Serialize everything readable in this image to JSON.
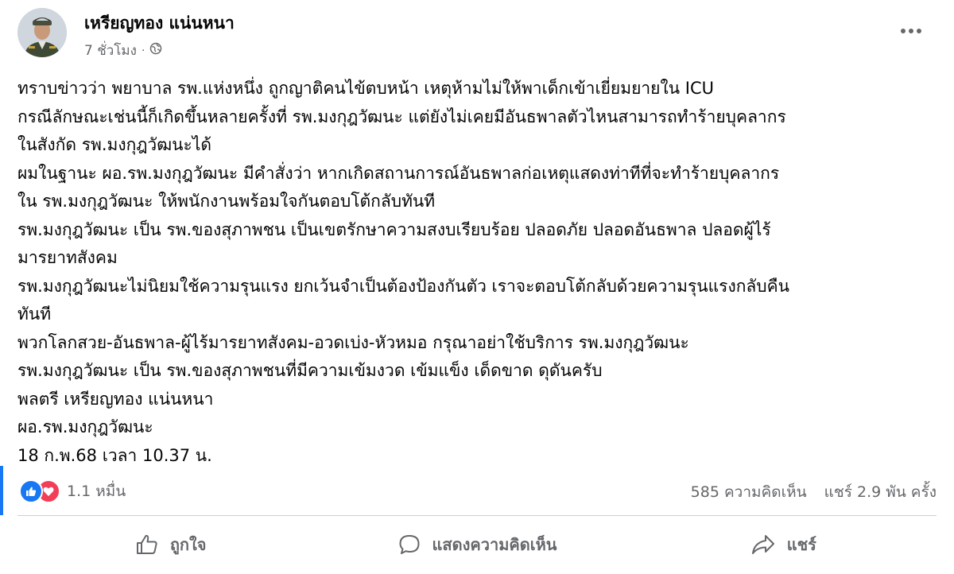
{
  "post": {
    "author": "เหรียญทอง แน่นหนา",
    "time": "7 ชั่วโมง",
    "privacy_icon": "globe-icon",
    "text_lines": [
      "ทราบข่าวว่า พยาบาล รพ.แห่งหนึ่ง ถูกญาติคนไข้ตบหน้า เหตุห้ามไม่ให้พาเด็กเข้าเยี่ยมยายใน ICU",
      "กรณีลักษณะเช่นนี้ก็เกิดขึ้นหลายครั้งที่ รพ.มงกุฎวัฒนะ แต่ยังไม่เคยมีอันธพาลตัวไหนสามารถทำร้ายบุคลากร",
      "ในสังกัด รพ.มงกุฎวัฒนะได้",
      "ผมในฐานะ ผอ.รพ.มงกุฎวัฒนะ มีคำสั่งว่า หากเกิดสถานการณ์อันธพาลก่อเหตุแสดงท่าทีที่จะทำร้ายบุคลากร",
      "ใน รพ.มงกุฎวัฒนะ ให้พนักงานพร้อมใจกันตอบโต้กลับทันที",
      "รพ.มงกุฎวัฒนะ เป็น รพ.ของสุภาพชน เป็นเขตรักษาความสงบเรียบร้อย ปลอดภัย ปลอดอันธพาล ปลอดผู้ไร้",
      "มารยาทสังคม",
      "รพ.มงกุฎวัฒนะไม่นิยมใช้ความรุนแรง ยกเว้นจำเป็นต้องป้องกันตัว เราจะตอบโต้กลับด้วยความรุนแรงกลับคืน",
      "ทันที",
      "พวกโลกสวย-อันธพาล-ผู้ไร้มารยาทสังคม-อวดเบ่ง-หัวหมอ กรุณาอย่าใช้บริการ รพ.มงกุฎวัฒนะ",
      "รพ.มงกุฎวัฒนะ เป็น รพ.ของสุภาพชนที่มีความเข้มงวด เข้มแข็ง เด็ดขาด ดุดันครับ",
      "พลตรี เหรียญทอง แน่นหนา",
      "ผอ.รพ.มงกุฎวัฒนะ",
      "18 ก.พ.68 เวลา 10.37 น."
    ]
  },
  "reactions": {
    "count": "1.1 หมื่น",
    "types": [
      "like",
      "love"
    ]
  },
  "stats": {
    "comments": "585 ความคิดเห็น",
    "shares": "แชร์ 2.9 พัน ครั้ง"
  },
  "actions": {
    "like": "ถูกใจ",
    "comment": "แสดงความคิดเห็น",
    "share": "แชร์"
  },
  "colors": {
    "accent": "#1877f2",
    "love": "#f33e58",
    "secondary_text": "#65676b"
  }
}
